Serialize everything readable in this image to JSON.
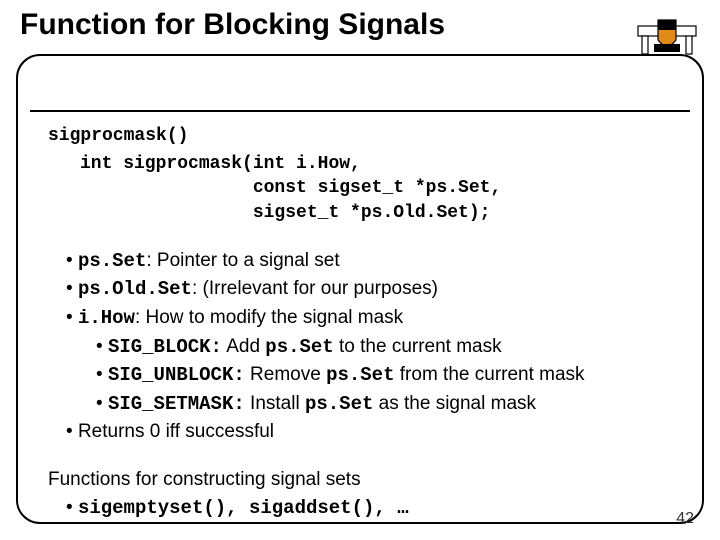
{
  "title": "Function for Blocking Signals",
  "fn_title": "sigprocmask()",
  "signature": {
    "l1": "int sigprocmask(int i.How,",
    "l2": "                const sigset_t *ps.Set,",
    "l3": "                sigset_t *ps.Old.Set);"
  },
  "bullets": {
    "psSet_code": "ps.Set",
    "psSet_text": ": Pointer to a signal set",
    "psOld_code": "ps.Old.Set",
    "psOld_text": ": (Irrelevant for our purposes)",
    "iHow_code": "i.How",
    "iHow_text": ": How to modify the signal mask",
    "block_code": "SIG_BLOCK:",
    "block_pre": " Add ",
    "block_arg": "ps.Set",
    "block_post": " to the current mask",
    "unblock_code": "SIG_UNBLOCK:",
    "unblock_pre": " Remove ",
    "unblock_arg": "ps.Set",
    "unblock_post": " from the current mask",
    "setmask_code": "SIG_SETMASK:",
    "setmask_pre": " Install ",
    "setmask_arg": "ps.Set",
    "setmask_post": " as the signal mask",
    "returns": "Returns 0 iff successful"
  },
  "footer": {
    "line1": "Functions for constructing signal sets",
    "fns": "sigemptyset(), sigaddset(), …"
  },
  "page_number": "42"
}
